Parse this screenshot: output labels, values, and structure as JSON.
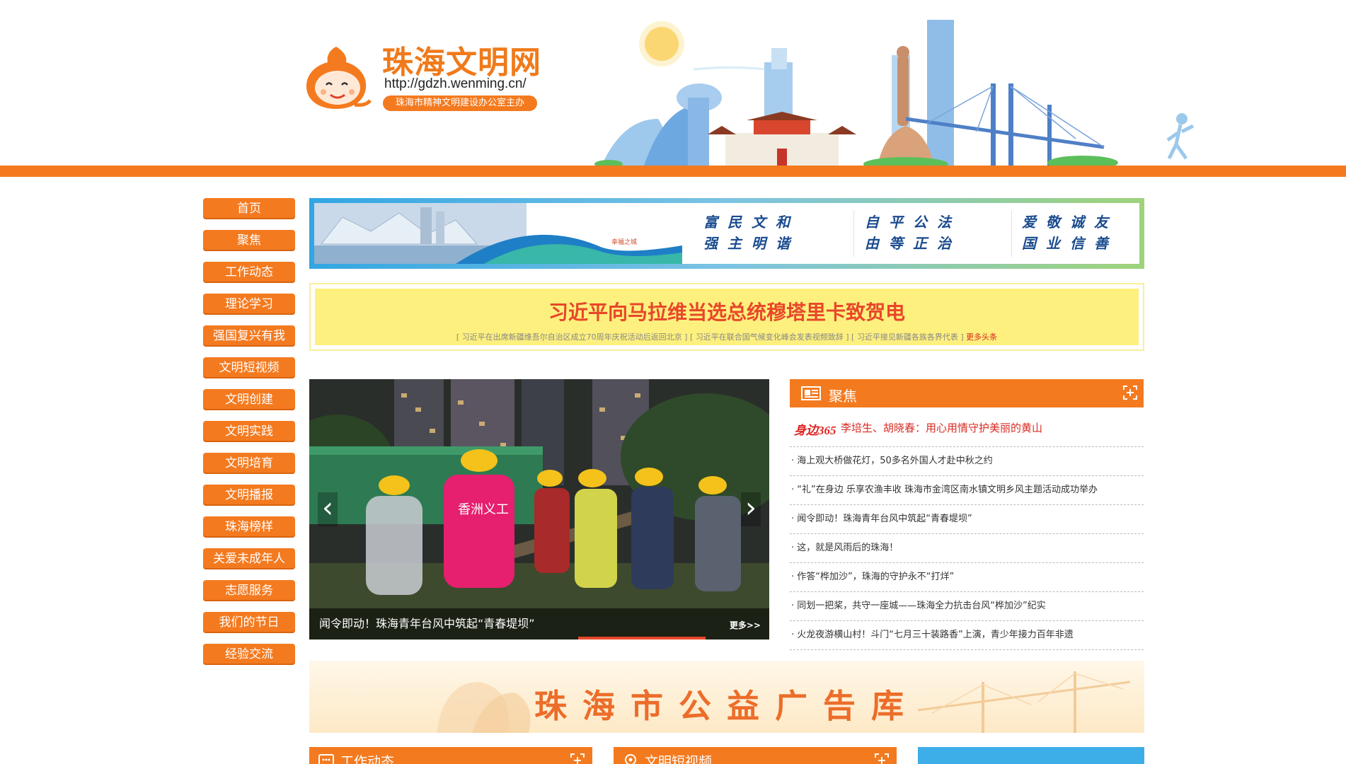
{
  "header": {
    "site_title": "珠海文明网",
    "site_url": "http://gdzh.wenming.cn/",
    "organizer": "珠海市精神文明建设办公室主办"
  },
  "nav": {
    "items": [
      {
        "label": "首页"
      },
      {
        "label": "聚焦"
      },
      {
        "label": "工作动态"
      },
      {
        "label": "理论学习"
      },
      {
        "label": "强国复兴有我"
      },
      {
        "label": "文明短视频"
      },
      {
        "label": "文明创建"
      },
      {
        "label": "文明实践"
      },
      {
        "label": "文明培育"
      },
      {
        "label": "文明播报"
      },
      {
        "label": "珠海榜样"
      },
      {
        "label": "关爱未成年人"
      },
      {
        "label": "志愿服务"
      },
      {
        "label": "我们的节日"
      },
      {
        "label": "经验交流"
      }
    ]
  },
  "banner": {
    "slogan_1": [
      "富民文和",
      "强主明谐"
    ],
    "slogan_2": [
      "自平公法",
      "由等正治"
    ],
    "slogan_3": [
      "爱敬诚友",
      "国业信善"
    ]
  },
  "headline": {
    "title": "习近平向马拉维当选总统穆塔里卡致贺电",
    "links": "[ 习近平在出席新疆维吾尔自治区成立70周年庆祝活动后返回北京 ] [ 习近平在联合国气候变化峰会发表视频致辞 ] [ 习近平接见新疆各族各界代表 ]",
    "more": "更多头条"
  },
  "slider": {
    "caption": "闻令即动！珠海青年台风中筑起“青春堤坝”",
    "more": "更多>>",
    "prev_icon": "chevron-left-icon",
    "next_icon": "chevron-right-icon",
    "progress": 0.28
  },
  "focus": {
    "title": "聚焦",
    "featured_tag": "身边365",
    "featured": "李培生、胡晓春：用心用情守护美丽的黄山",
    "items": [
      "· 海上观大桥做花灯，50多名外国人才赴中秋之约",
      "· “礼”在身边 乐享农渔丰收 珠海市金湾区南水镇文明乡风主题活动成功举办",
      "· 闻令即动！珠海青年台风中筑起“青春堤坝”",
      "· 这，就是风雨后的珠海！",
      "· 作答“桦加沙”，珠海的守护永不“打烊”",
      "· 同划一把桨，共守一座城——珠海全力抗击台风“桦加沙”纪实",
      "· 火龙夜游横山村！斗门“七月三十装路香”上演，青少年接力百年非遗"
    ]
  },
  "ad_banner": {
    "title": "珠海市公益广告库"
  },
  "bottom": {
    "panel_1": "工作动态",
    "panel_2": "文明短视频"
  },
  "colors": {
    "accent": "#f47a1f",
    "headline_red": "#e8472a",
    "headline_bg": "#fdf07e",
    "banner_blue": "#32a6e3",
    "slogan_blue": "#1a4b8e"
  }
}
